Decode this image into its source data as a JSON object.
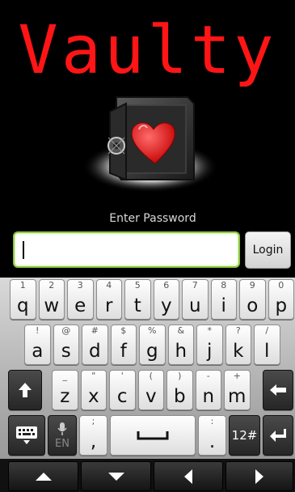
{
  "app": {
    "title": "Vaulty",
    "password_label": "Enter Password",
    "password_value": "",
    "login_label": "Login",
    "accent_color": "#ff1515",
    "input_border_color": "#8dc63f"
  },
  "keyboard": {
    "row1": [
      {
        "hint": "1",
        "main": "q"
      },
      {
        "hint": "2",
        "main": "w"
      },
      {
        "hint": "3",
        "main": "e"
      },
      {
        "hint": "4",
        "main": "r"
      },
      {
        "hint": "5",
        "main": "t"
      },
      {
        "hint": "6",
        "main": "y"
      },
      {
        "hint": "7",
        "main": "u"
      },
      {
        "hint": "8",
        "main": "i"
      },
      {
        "hint": "9",
        "main": "o"
      },
      {
        "hint": "0",
        "main": "p"
      }
    ],
    "row2": [
      {
        "hint": "!",
        "main": "a"
      },
      {
        "hint": "@",
        "main": "s"
      },
      {
        "hint": "#",
        "main": "d"
      },
      {
        "hint": "$",
        "main": "f"
      },
      {
        "hint": "%",
        "main": "g"
      },
      {
        "hint": "&",
        "main": "h"
      },
      {
        "hint": "*",
        "main": "j"
      },
      {
        "hint": "?",
        "main": "k"
      },
      {
        "hint": "/",
        "main": "l"
      }
    ],
    "row3": [
      {
        "hint": "_",
        "main": "z"
      },
      {
        "hint": "\"",
        "main": "x"
      },
      {
        "hint": "'",
        "main": "c"
      },
      {
        "hint": "(",
        "main": "v"
      },
      {
        "hint": ")",
        "main": "b"
      },
      {
        "hint": "-",
        "main": "n"
      },
      {
        "hint": "+",
        "main": "m"
      }
    ],
    "mic_label": "EN",
    "comma_hint": ";",
    "comma_main": ",",
    "period_hint": ":",
    "period_main": ".",
    "symbols_label": "12#",
    "icons": {
      "shift": "shift-arrow-icon",
      "backspace": "backspace-arrow-icon",
      "keyboard": "keyboard-hide-icon",
      "mic": "microphone-icon",
      "space": "space-bar-icon",
      "enter": "enter-arrow-icon",
      "nav_up": "arrow-up-icon",
      "nav_down": "arrow-down-icon",
      "nav_left": "arrow-left-icon",
      "nav_right": "arrow-right-icon"
    }
  }
}
